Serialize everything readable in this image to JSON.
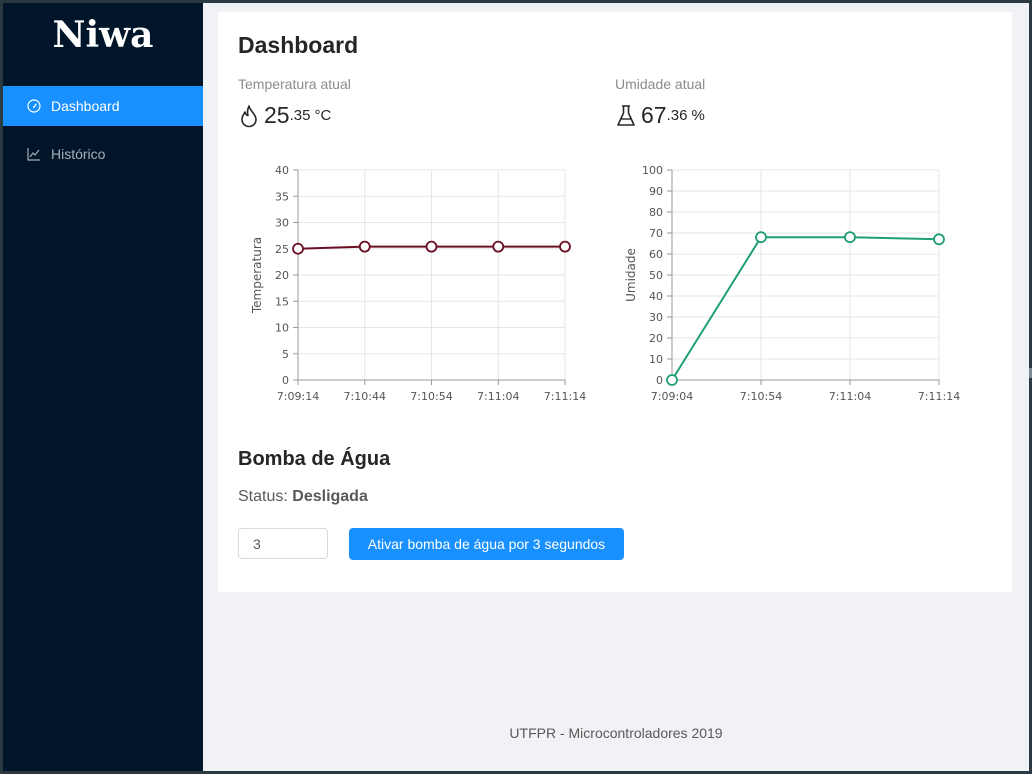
{
  "brand": {
    "name": "Niwa"
  },
  "sidebar": {
    "items": [
      {
        "label": "Dashboard",
        "icon": "dashboard-icon",
        "active": true
      },
      {
        "label": "Histórico",
        "icon": "line-chart-icon",
        "active": false
      }
    ]
  },
  "page": {
    "title": "Dashboard"
  },
  "stats": {
    "temperature": {
      "label": "Temperatura atual",
      "int": "25",
      "dec": ".35",
      "unit": "°C",
      "icon": "flame-icon"
    },
    "humidity": {
      "label": "Umidade atual",
      "int": "67",
      "dec": ".36",
      "unit": "%",
      "icon": "flask-icon"
    }
  },
  "colors": {
    "accent": "#1890ff",
    "sidebar": "#001529",
    "temp_line": "#6b0f24",
    "hum_line": "#1f9e77"
  },
  "chart_data": [
    {
      "type": "line",
      "ylabel": "Temperatura",
      "x": [
        "7:09:14",
        "7:10:44",
        "7:10:54",
        "7:11:04",
        "7:11:14"
      ],
      "series": [
        {
          "values": [
            25.0,
            25.4,
            25.4,
            25.4,
            25.4
          ]
        }
      ],
      "ylim": [
        0,
        40
      ],
      "yticks": [
        0,
        5,
        10,
        15,
        20,
        25,
        30,
        35,
        40
      ],
      "grid": true
    },
    {
      "type": "line",
      "ylabel": "Umidade",
      "x": [
        "7:09:04",
        "7:10:54",
        "7:11:04",
        "7:11:14"
      ],
      "series": [
        {
          "values": [
            0,
            68,
            68,
            67
          ]
        }
      ],
      "ylim": [
        0,
        100
      ],
      "yticks": [
        0,
        10,
        20,
        30,
        40,
        50,
        60,
        70,
        80,
        90,
        100
      ],
      "grid": true
    }
  ],
  "pump": {
    "title": "Bomba de Água",
    "status_label": "Status:",
    "status_value": "Desligada",
    "seconds_value": "3",
    "button_label": "Ativar bomba de água por 3 segundos"
  },
  "footer": {
    "text": "UTFPR - Microcontroladores 2019"
  }
}
